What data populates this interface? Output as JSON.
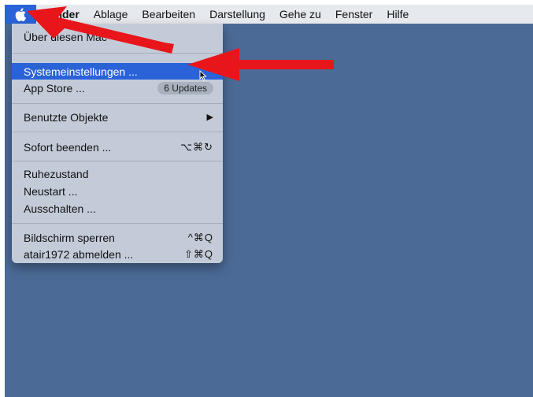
{
  "menubar": {
    "apple_menu": "apple-icon",
    "items": [
      "Finder",
      "Ablage",
      "Bearbeiten",
      "Darstellung",
      "Gehe zu",
      "Fenster",
      "Hilfe"
    ]
  },
  "apple_menu": {
    "about": "Über diesen Mac",
    "system_settings": "Systemeinstellungen ...",
    "app_store": "App Store ...",
    "app_store_badge": "6 Updates",
    "recent_items": "Benutzte Objekte",
    "recent_items_arrow": "▶",
    "force_quit": "Sofort beenden ...",
    "force_quit_shortcut": "⌥⌘↻",
    "sleep": "Ruhezustand",
    "restart": "Neustart ...",
    "shutdown": "Ausschalten ...",
    "lock_screen": "Bildschirm sperren",
    "lock_screen_shortcut": "^⌘Q",
    "logout": "atair1972 abmelden ...",
    "logout_shortcut": "⇧⌘Q"
  },
  "colors": {
    "desktop": "#4b6a96",
    "menubar": "#e6e9ee",
    "menu_background": "#c4cbd8",
    "highlight": "#2a62d8",
    "annotation_arrow": "#e8161b"
  }
}
